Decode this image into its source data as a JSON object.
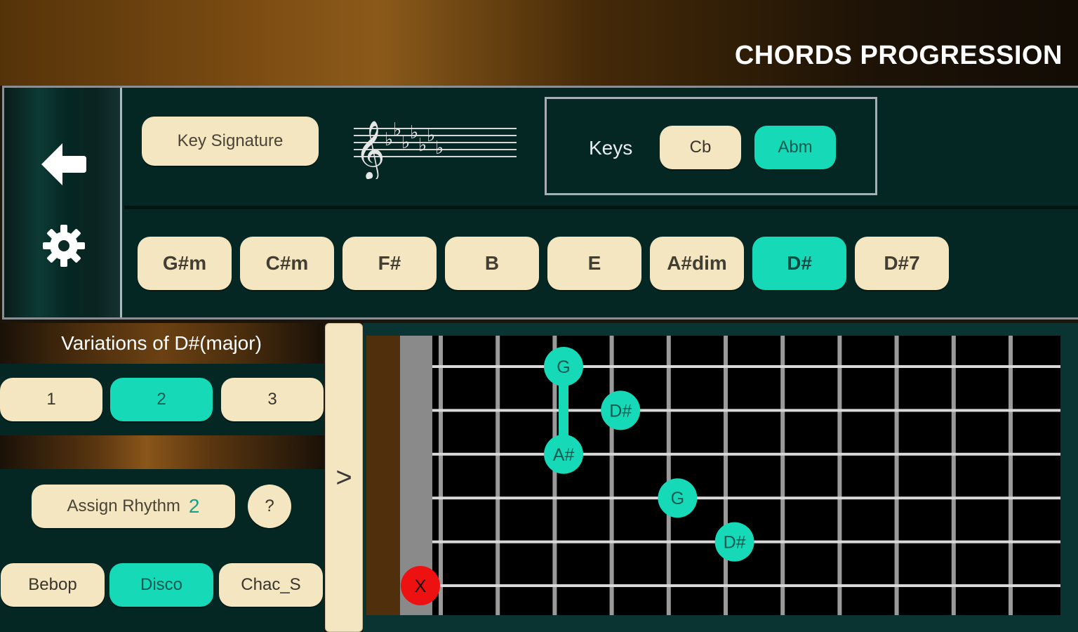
{
  "header": {
    "title": "CHORDS PROGRESSION"
  },
  "sidebar": {
    "back_icon": "back-arrow-icon",
    "settings_icon": "gear-icon"
  },
  "key_signature": {
    "button_label": "Key Signature",
    "flats_shown": 7
  },
  "keys": {
    "label": "Keys",
    "options": [
      "Cb",
      "Abm"
    ],
    "selected": "Abm"
  },
  "chords": {
    "items": [
      "G#m",
      "C#m",
      "F#",
      "B",
      "E",
      "A#dim",
      "D#",
      "D#7"
    ],
    "selected": "D#"
  },
  "variations": {
    "title": "Variations of  D#(major)",
    "options": [
      "1",
      "2",
      "3"
    ],
    "selected": "2"
  },
  "rhythm": {
    "assign_label": "Assign Rhythm",
    "assign_number": "2",
    "help_label": "?",
    "styles": [
      "Bebop",
      "Disco",
      "Chac_S"
    ],
    "selected": "Disco"
  },
  "expand": {
    "label": ">"
  },
  "fretboard": {
    "strings": 6,
    "frets_visible": 11,
    "notes": [
      {
        "label": "G",
        "string": 1,
        "fret": 3
      },
      {
        "label": "D#",
        "string": 2,
        "fret": 4
      },
      {
        "label": "A#",
        "string": 3,
        "fret": 3
      },
      {
        "label": "G",
        "string": 4,
        "fret": 5
      },
      {
        "label": "D#",
        "string": 5,
        "fret": 6
      }
    ],
    "barre": {
      "fret": 3,
      "from_string": 1,
      "to_string": 3
    },
    "muted": [
      {
        "label": "X",
        "string": 6
      }
    ],
    "colors": {
      "note": "#16d9b8",
      "note_text": "#0b5a50",
      "muted": "#ee1111",
      "muted_text": "#1a0000",
      "string": "#d9d9d9",
      "fret": "#9a9a9a",
      "nut": "#8a8a8a"
    }
  }
}
